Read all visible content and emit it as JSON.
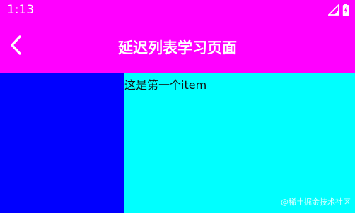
{
  "status_bar": {
    "time": "1:13",
    "icons": [
      "signal-icon",
      "battery-icon"
    ]
  },
  "toolbar": {
    "back_icon": "back-arrow-icon",
    "title": "延迟列表学习页面"
  },
  "list": {
    "items": [
      {
        "label": "这是第一个item"
      }
    ]
  },
  "watermark": "@稀土掘金技术社区",
  "colors": {
    "appbar": "#ff00ff",
    "left_panel": "#0000ff",
    "content_background": "#00ffff",
    "title_text": "#ffffff"
  }
}
